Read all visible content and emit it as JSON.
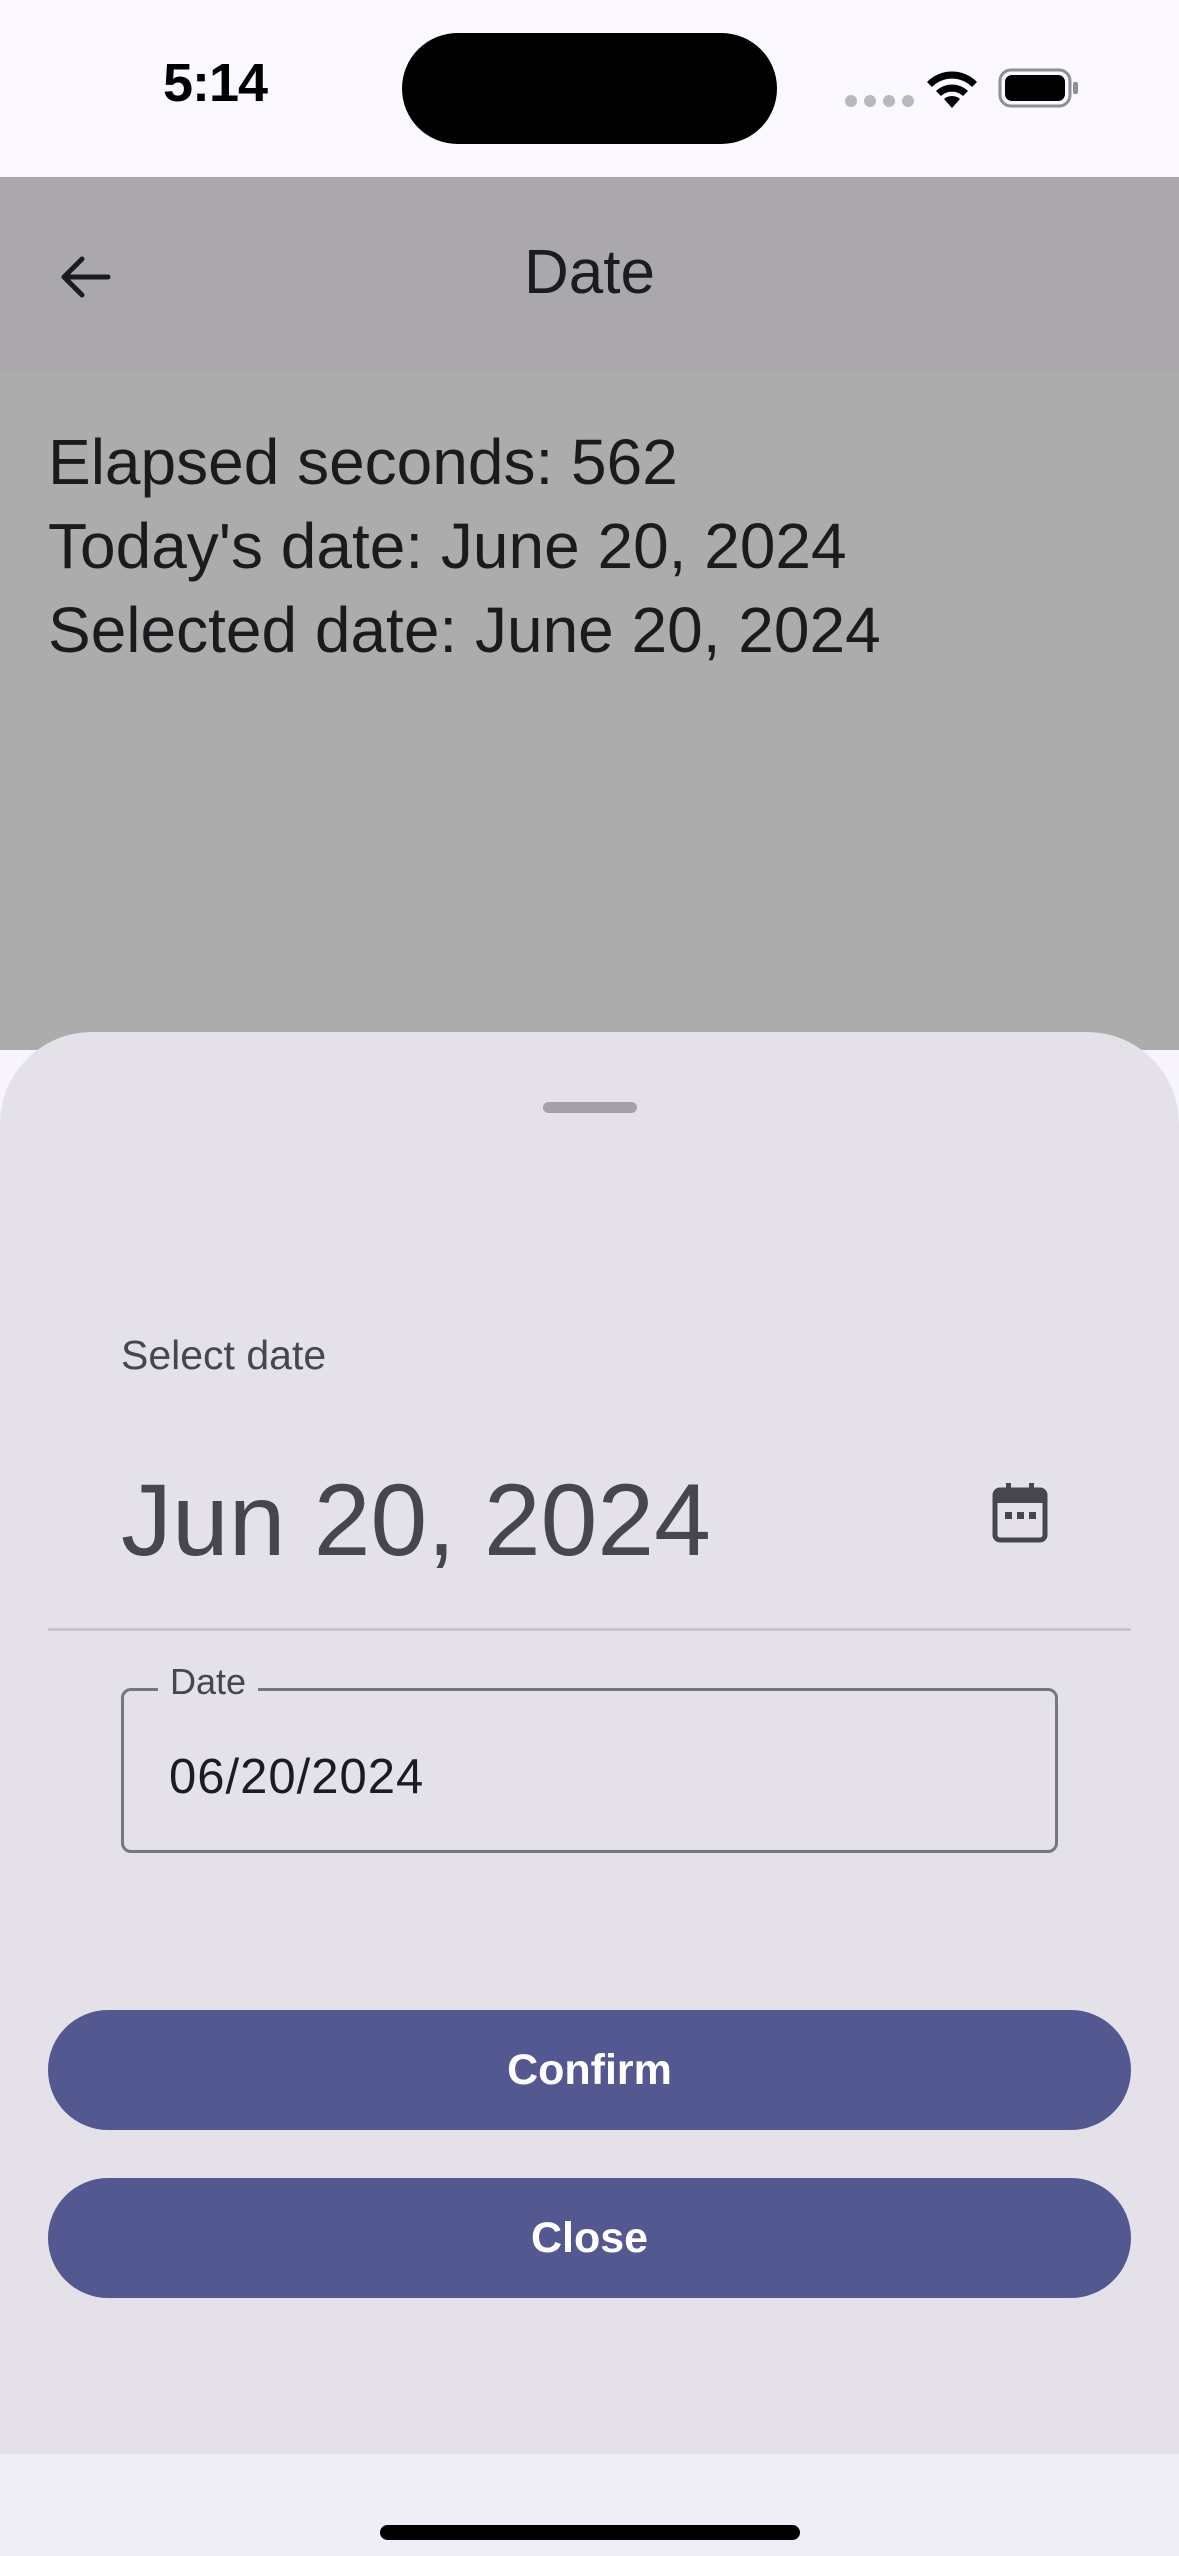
{
  "status_bar": {
    "time": "5:14"
  },
  "app_bar": {
    "title": "Date"
  },
  "info": {
    "elapsed": "Elapsed seconds: 562",
    "today": "Today's date: June 20, 2024",
    "selected": "Selected date: June 20, 2024"
  },
  "sheet": {
    "select_label": "Select date",
    "headline_date": "Jun 20, 2024",
    "field_label": "Date",
    "field_value": "06/20/2024",
    "confirm_label": "Confirm",
    "close_label": "Close"
  },
  "icons": {
    "back": "arrow-back-icon",
    "calendar": "calendar-icon",
    "wifi": "wifi-icon",
    "battery": "battery-icon"
  },
  "colors": {
    "primary": "#535890",
    "sheet_bg": "#e4e1e9",
    "scrim": "#acacac"
  }
}
